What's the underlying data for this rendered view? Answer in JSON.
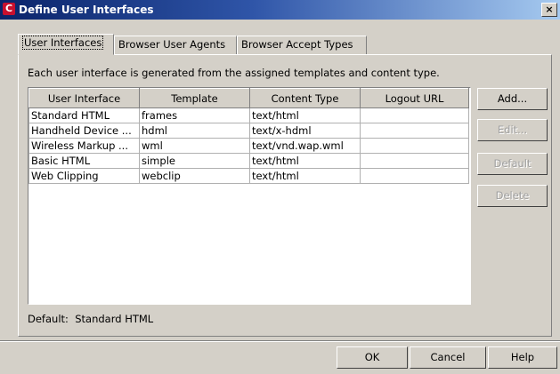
{
  "window": {
    "title": "Define User Interfaces",
    "close_glyph": "×",
    "app_icon_glyph": "C",
    "app_icon_color": "#c8102e"
  },
  "tabs": [
    {
      "label": "User Interfaces",
      "active": true
    },
    {
      "label": "Browser User Agents",
      "active": false
    },
    {
      "label": "Browser Accept Types",
      "active": false
    }
  ],
  "description": "Each user interface is generated from the assigned templates and content type.",
  "table": {
    "columns": [
      "User Interface",
      "Template",
      "Content Type",
      "Logout URL"
    ],
    "rows": [
      [
        "Standard HTML",
        "frames",
        "text/html",
        ""
      ],
      [
        "Handheld Device ...",
        "hdml",
        "text/x-hdml",
        ""
      ],
      [
        "Wireless Markup ...",
        "wml",
        "text/vnd.wap.wml",
        ""
      ],
      [
        "Basic HTML",
        "simple",
        "text/html",
        ""
      ],
      [
        "Web Clipping",
        "webclip",
        "text/html",
        ""
      ]
    ]
  },
  "side_buttons": {
    "add": "Add...",
    "edit": "Edit...",
    "default": "Default",
    "delete": "Delete"
  },
  "default_label": "Default:",
  "default_value": "Standard HTML",
  "footer_buttons": {
    "ok": "OK",
    "cancel": "Cancel",
    "help": "Help"
  },
  "colors": {
    "titlebar_start": "#0a246a",
    "titlebar_end": "#a6caf0",
    "face": "#d4d0c8"
  }
}
